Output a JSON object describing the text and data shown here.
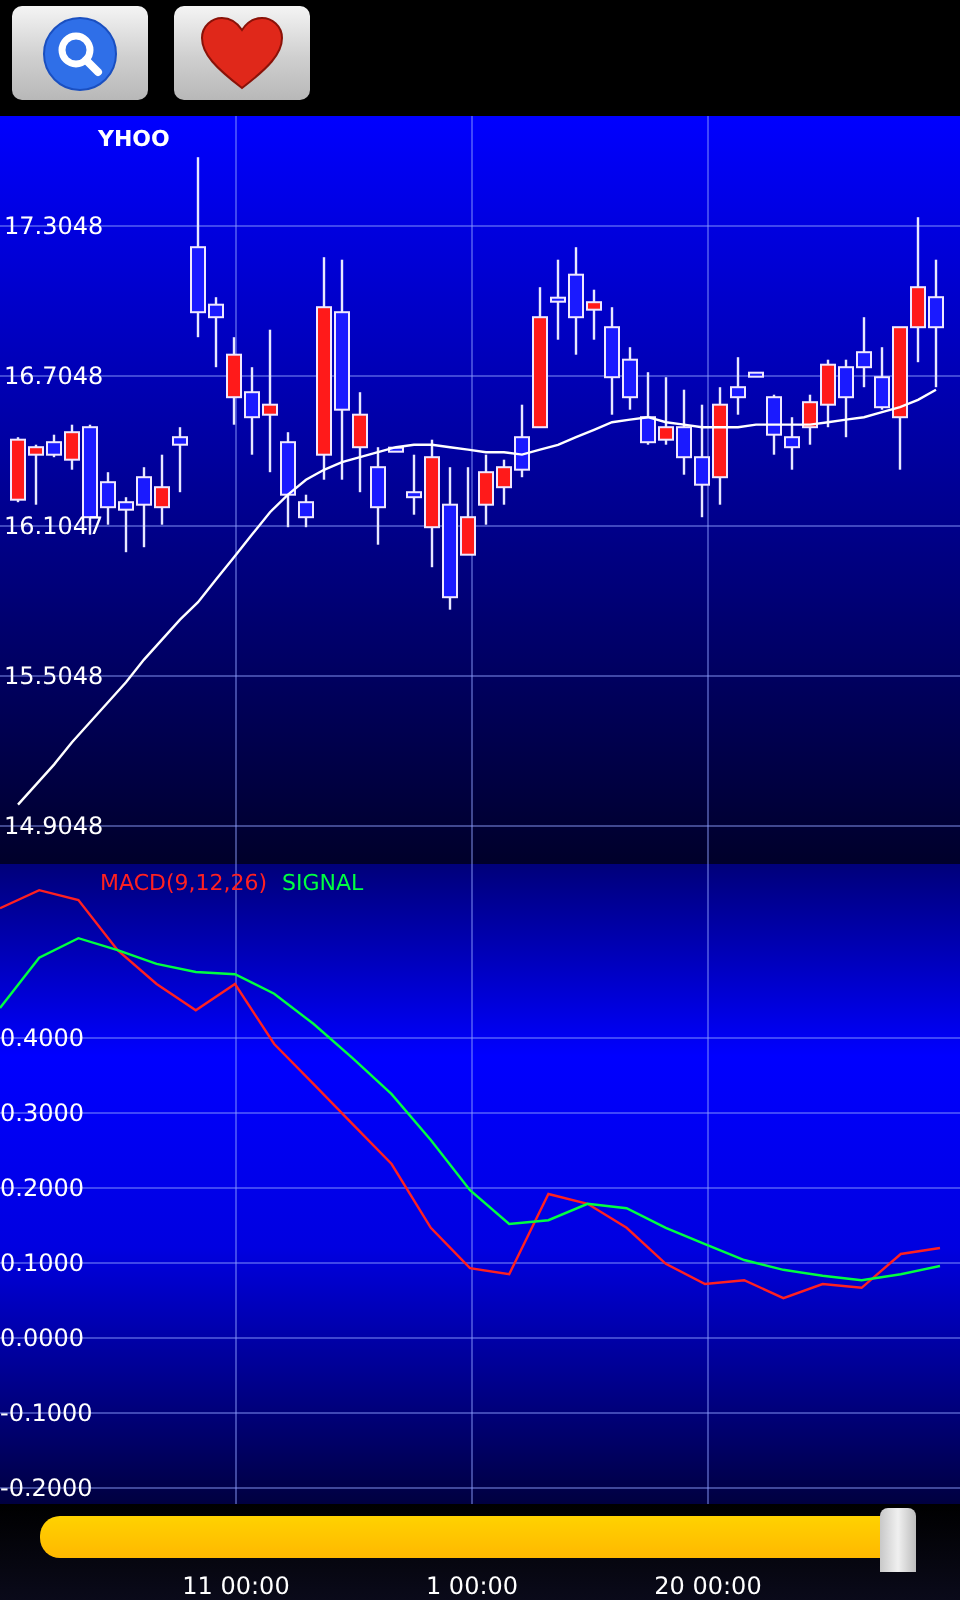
{
  "price_panel": {
    "chart_data": {
      "type": "candlestick",
      "title": "YHOO",
      "grid": true,
      "ylim": [
        11.8088,
        18.2088
      ],
      "categories": [
        null,
        null,
        null,
        null,
        null,
        null,
        null,
        null,
        null,
        null,
        null,
        null,
        null,
        null,
        null,
        null,
        null,
        null,
        null,
        null,
        null,
        null,
        null,
        null,
        null,
        null,
        null,
        null,
        null,
        null,
        null,
        null,
        null,
        null,
        null,
        null,
        null,
        null,
        null,
        null,
        null,
        null,
        null,
        null,
        null,
        null,
        null,
        null,
        null,
        null,
        null,
        null
      ],
      "yticks": [
        {
          "value": 17.3048,
          "label": "17.3048"
        },
        {
          "value": 16.7048,
          "label": "16.7048"
        },
        {
          "value": 16.1047,
          "label": "16.1047"
        },
        {
          "value": 15.5048,
          "label": "15.5048"
        },
        {
          "value": 14.9048,
          "label": "14.9048"
        }
      ],
      "ohlc": [
        [
          16.21,
          16.46,
          16.2,
          16.45
        ],
        [
          16.39,
          16.43,
          16.19,
          16.42
        ],
        [
          16.44,
          16.47,
          16.38,
          16.39
        ],
        [
          16.37,
          16.51,
          16.33,
          16.48
        ],
        [
          16.5,
          16.51,
          16.07,
          16.14
        ],
        [
          16.28,
          16.32,
          16.11,
          16.18
        ],
        [
          16.2,
          16.22,
          16.0,
          16.17
        ],
        [
          16.3,
          16.34,
          16.02,
          16.19
        ],
        [
          16.18,
          16.39,
          16.11,
          16.26
        ],
        [
          16.46,
          16.5,
          16.24,
          16.43
        ],
        [
          17.22,
          17.58,
          16.86,
          16.96
        ],
        [
          16.99,
          17.02,
          16.74,
          16.94
        ],
        [
          16.62,
          16.86,
          16.51,
          16.79
        ],
        [
          16.64,
          16.74,
          16.39,
          16.54
        ],
        [
          16.55,
          16.89,
          16.32,
          16.59
        ],
        [
          16.44,
          16.48,
          16.1,
          16.23
        ],
        [
          16.2,
          16.23,
          16.1,
          16.14
        ],
        [
          16.39,
          17.18,
          16.29,
          16.98
        ],
        [
          16.96,
          17.17,
          16.29,
          16.57
        ],
        [
          16.42,
          16.64,
          16.24,
          16.55
        ],
        [
          16.34,
          16.42,
          16.03,
          16.18
        ],
        [
          16.41,
          16.41,
          16.41,
          16.41
        ],
        [
          16.24,
          16.39,
          16.15,
          16.22
        ],
        [
          16.1,
          16.45,
          15.94,
          16.38
        ],
        [
          16.19,
          16.34,
          15.77,
          15.82
        ],
        [
          15.99,
          16.34,
          15.99,
          16.14
        ],
        [
          16.19,
          16.39,
          16.11,
          16.32
        ],
        [
          16.26,
          16.37,
          16.19,
          16.34
        ],
        [
          16.46,
          16.59,
          16.3,
          16.33
        ],
        [
          16.5,
          17.06,
          16.5,
          16.94
        ],
        [
          17.01,
          17.17,
          16.85,
          17.01
        ],
        [
          17.11,
          17.22,
          16.79,
          16.94
        ],
        [
          16.97,
          17.05,
          16.85,
          17.0
        ],
        [
          16.9,
          16.98,
          16.55,
          16.7
        ],
        [
          16.77,
          16.82,
          16.57,
          16.62
        ],
        [
          16.54,
          16.72,
          16.43,
          16.44
        ],
        [
          16.45,
          16.7,
          16.43,
          16.5
        ],
        [
          16.5,
          16.65,
          16.31,
          16.38
        ],
        [
          16.38,
          16.59,
          16.14,
          16.27
        ],
        [
          16.3,
          16.66,
          16.19,
          16.59
        ],
        [
          16.66,
          16.78,
          16.55,
          16.62
        ],
        [
          16.71,
          16.71,
          16.71,
          16.71
        ],
        [
          16.62,
          16.63,
          16.39,
          16.47
        ],
        [
          16.46,
          16.54,
          16.33,
          16.42
        ],
        [
          16.5,
          16.63,
          16.43,
          16.6
        ],
        [
          16.59,
          16.77,
          16.5,
          16.75
        ],
        [
          16.74,
          16.77,
          16.46,
          16.62
        ],
        [
          16.8,
          16.94,
          16.66,
          16.74
        ],
        [
          16.7,
          16.82,
          16.57,
          16.58
        ],
        [
          16.54,
          16.9,
          16.33,
          16.9
        ],
        [
          16.9,
          17.34,
          16.76,
          17.06
        ],
        [
          17.02,
          17.17,
          16.66,
          16.9
        ]
      ],
      "series": [
        {
          "type": "line",
          "color": "#ffffff",
          "values": [
            14.99,
            15.07,
            15.15,
            15.24,
            15.32,
            15.4,
            15.48,
            15.57,
            15.65,
            15.73,
            15.8,
            15.89,
            15.98,
            16.07,
            16.16,
            16.23,
            16.29,
            16.33,
            16.36,
            16.38,
            16.4,
            16.42,
            16.43,
            16.43,
            16.42,
            16.41,
            16.4,
            16.4,
            16.39,
            16.41,
            16.43,
            16.46,
            16.49,
            16.52,
            16.53,
            16.54,
            16.52,
            16.51,
            16.5,
            16.5,
            16.5,
            16.51,
            16.51,
            16.51,
            16.51,
            16.52,
            16.53,
            16.54,
            16.56,
            16.58,
            16.61,
            16.65
          ]
        }
      ]
    }
  },
  "macd_panel": {
    "chart_data": {
      "type": "line",
      "grid": true,
      "ylim": [
        -0.3493,
        1.784
      ],
      "categories": [
        null,
        null,
        null,
        null,
        null,
        null,
        null,
        null,
        null,
        null,
        null,
        null,
        null,
        null,
        null,
        null,
        null,
        null,
        null,
        null,
        null,
        null,
        null,
        null,
        null
      ],
      "yticks": [
        {
          "value": 0.4,
          "label": "0.4000"
        },
        {
          "value": 0.3,
          "label": "0.3000"
        },
        {
          "value": 0.2,
          "label": "0.2000"
        },
        {
          "value": 0.1,
          "label": "0.1000"
        },
        {
          "value": 0,
          "label": "0.0000"
        },
        {
          "value": -0.1,
          "label": "-0.1000"
        },
        {
          "value": -0.2,
          "label": "-0.2000"
        }
      ],
      "series": [
        {
          "name": "MACD(9,12,26)",
          "color": "#ff2020",
          "values": [
            0.573,
            0.597,
            0.584,
            0.517,
            0.472,
            0.437,
            0.472,
            0.392,
            0.339,
            0.285,
            0.232,
            0.147,
            0.093,
            0.085,
            0.192,
            0.179,
            0.147,
            0.099,
            0.072,
            0.077,
            0.053,
            0.072,
            0.067,
            0.112,
            0.12
          ]
        },
        {
          "name": "SIGNAL",
          "color": "#00ff40",
          "values": [
            0.44,
            0.507,
            0.533,
            0.517,
            0.499,
            0.488,
            0.485,
            0.459,
            0.419,
            0.373,
            0.325,
            0.264,
            0.197,
            0.152,
            0.157,
            0.179,
            0.173,
            0.147,
            0.125,
            0.104,
            0.091,
            0.083,
            0.077,
            0.085,
            0.096
          ]
        }
      ]
    }
  },
  "time_slider": {
    "level": 0.96
  },
  "time_axis": [
    "11 00:00",
    "1 00:00",
    "20 00:00"
  ]
}
